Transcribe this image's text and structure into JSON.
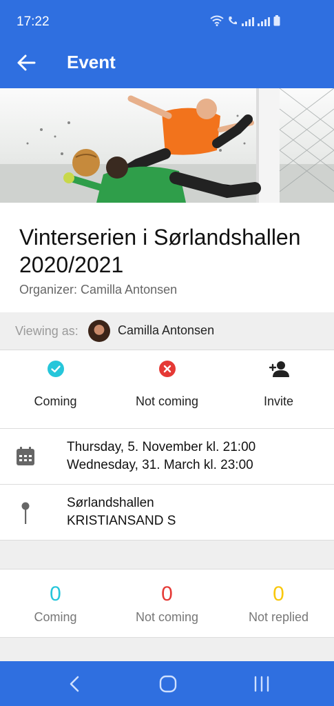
{
  "status_bar": {
    "time": "17:22"
  },
  "app_bar": {
    "title": "Event",
    "back_icon": "arrow-left-icon"
  },
  "hero": {
    "image": "soccer-goalkeeper-photo"
  },
  "event": {
    "title": "Vinterserien i Sørlandshallen 2020/2021",
    "organizer": "Organizer: Camilla Antonsen"
  },
  "viewing_as": {
    "label": "Viewing as:",
    "name": "Camilla Antonsen"
  },
  "rsvp": [
    {
      "label": "Coming",
      "icon": "check-circle-icon",
      "color": "#26c6da"
    },
    {
      "label": "Not coming",
      "icon": "x-circle-icon",
      "color": "#e53935"
    },
    {
      "label": "Invite",
      "icon": "person-add-icon",
      "color": "#222222"
    }
  ],
  "date": {
    "icon": "calendar-icon",
    "start": "Thursday, 5. November kl. 21:00",
    "end": "Wednesday, 31. March kl. 23:00"
  },
  "location": {
    "icon": "map-pin-icon",
    "venue": "Sørlandshallen",
    "city": "KRISTIANSAND S"
  },
  "counts": [
    {
      "value": "0",
      "label": "Coming",
      "color": "#26c6da"
    },
    {
      "value": "0",
      "label": "Not coming",
      "color": "#e53935"
    },
    {
      "value": "0",
      "label": "Not replied",
      "color": "#f9c80e"
    }
  ],
  "nav_bar": {
    "back": "nav-back-icon",
    "home": "nav-home-icon",
    "recents": "nav-recents-icon"
  },
  "colors": {
    "primary": "#2f6fe0",
    "divider": "#dcdcdc"
  }
}
